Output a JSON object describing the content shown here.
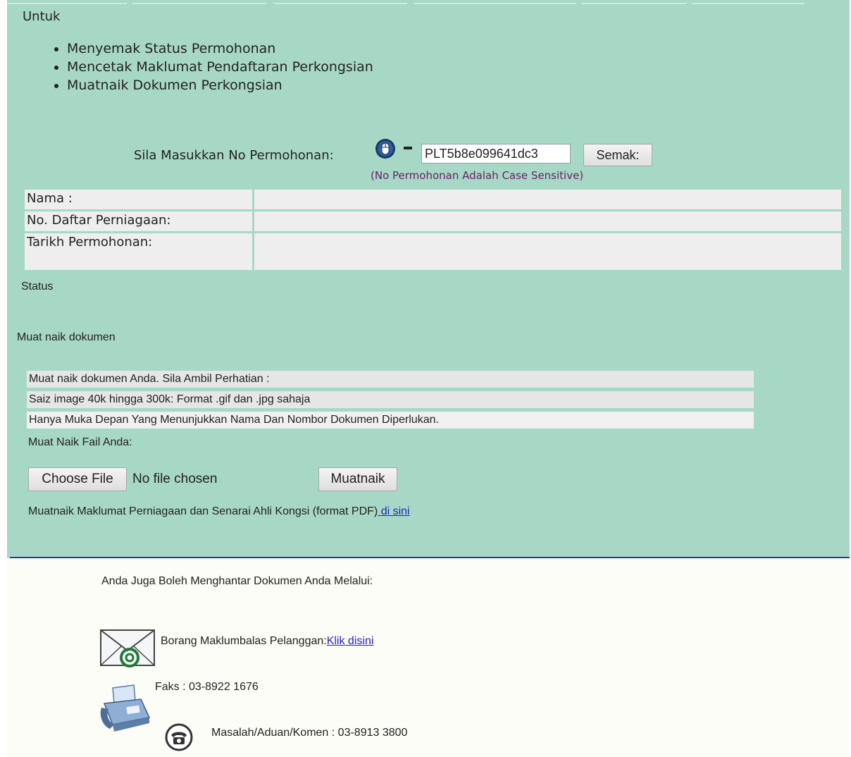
{
  "intro": {
    "heading": "Untuk",
    "items": [
      "Menyemak Status Permohonan",
      "Mencetak Maklumat Pendaftaran Perkongsian",
      "Muatnaik Dokumen Perkongsian"
    ]
  },
  "search": {
    "label": "Sila Masukkan No Permohonan:",
    "value": "PLT5b8e099641dc3",
    "button_label": "Semak:",
    "note": "(No Permohonan Adalah Case Sensitive)"
  },
  "info_table": {
    "rows": [
      {
        "label": "Nama :",
        "value": ""
      },
      {
        "label": "No. Daftar Perniagaan:",
        "value": ""
      },
      {
        "label": "Tarikh Permohonan:",
        "value": ""
      }
    ]
  },
  "status_label": "Status",
  "upload": {
    "section_label": "Muat naik dokumen",
    "notes": [
      "Muat naik dokumen Anda. Sila Ambil Perhatian :",
      "Saiz image 40k hingga 300k: Format .gif dan .jpg sahaja",
      "Hanya Muka Depan Yang Menunjukkan Nama Dan Nombor Dokumen Diperlukan."
    ],
    "file_label": "Muat Naik Fail Anda:",
    "choose_button": "Choose File",
    "file_status": "No file chosen",
    "upload_button": "Muatnaik",
    "pdf_text": "Muatnaik Maklumat Perniagaan dan Senarai Ahli Kongsi (format PDF)",
    "pdf_link": " di sini"
  },
  "alternatives": {
    "title": "Anda Juga Boleh Menghantar Dokumen Anda Melalui:",
    "borang_text": "Borang Maklumbalas Pelanggan:",
    "borang_link": "Klik disini",
    "faks": "Faks : 03-8922 1676",
    "aduan": "Masalah/Aduan/Komen : 03-8913 3800"
  },
  "colors": {
    "panel_green": "#a7d8c5",
    "link_blue": "#2323c6",
    "note_purple": "#6a1e6a",
    "divider_blue": "#2b36b8"
  },
  "icons": [
    "mouse-icon",
    "email-icon",
    "fax-icon",
    "phone-icon"
  ]
}
